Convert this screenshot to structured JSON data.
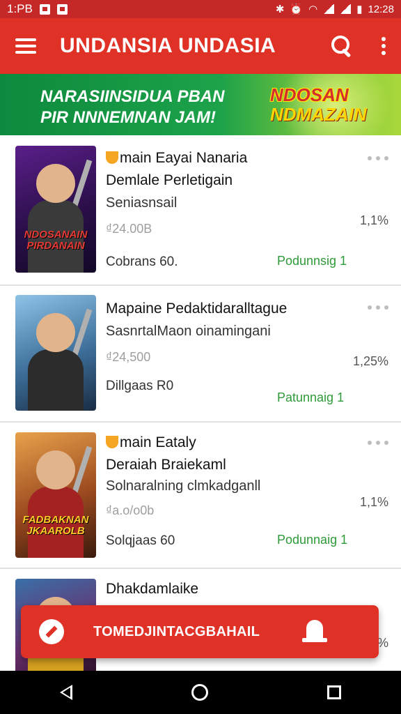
{
  "status_bar": {
    "time_left": "1:PB",
    "time_right": "12:28"
  },
  "app_bar": {
    "title": "UNDANSIA UNDASIA"
  },
  "banner": {
    "line1": "NARASIINSIDUA PBAN",
    "line2": "PIR NNNEMNAN JAM!",
    "logo_line1": "NDOSAN",
    "logo_line2": "NDMAZAIN"
  },
  "items": [
    {
      "title": "main Eayai Nanaria",
      "subtitle": "Demlale Perletigain",
      "desc": "Seniasnsail",
      "price": "₫24.00B",
      "footer": "Cobrans 60.",
      "status": "Podunnsig 1",
      "percent": "1,1%",
      "cover_text": "NDOSANAIN PIRDANAIN",
      "has_badge": true
    },
    {
      "title": "Mapaine Pedaktidaralltague",
      "subtitle": "",
      "desc": "SasnrtalMaon oinamingani",
      "price": "₫24,500",
      "footer": "Dillgaas R0",
      "status": "Patunnaig 1",
      "percent": "1,25%",
      "cover_text": "",
      "has_badge": false
    },
    {
      "title": "main Eataly",
      "subtitle": "Deraiah Braiekaml",
      "desc": "Solnaralning clmkadganll",
      "price": "₫a.o/o0b",
      "footer": "Solqjaas 60",
      "status": "Podunnaig 1",
      "percent": "1,1%",
      "cover_text": "FADBAKNAN JKAAROLB",
      "has_badge": true
    },
    {
      "title": "Dhakdamlaike",
      "subtitle": "",
      "desc": "",
      "price": "",
      "footer": "",
      "status": "",
      "percent": "%",
      "cover_text": "",
      "has_badge": false
    }
  ],
  "toast": {
    "label": "TOMEDJINTACGBAHAIL"
  },
  "icons": {
    "menu": "menu-icon",
    "search": "search-icon",
    "more": "more-vert-icon",
    "badge": "badge-icon",
    "toast_left": "no-entry-icon",
    "toast_right": "bell-icon"
  },
  "colors": {
    "primary": "#e03127",
    "status_bar": "#c62828",
    "banner": "#1da24a",
    "status_text": "#2e9a38"
  }
}
